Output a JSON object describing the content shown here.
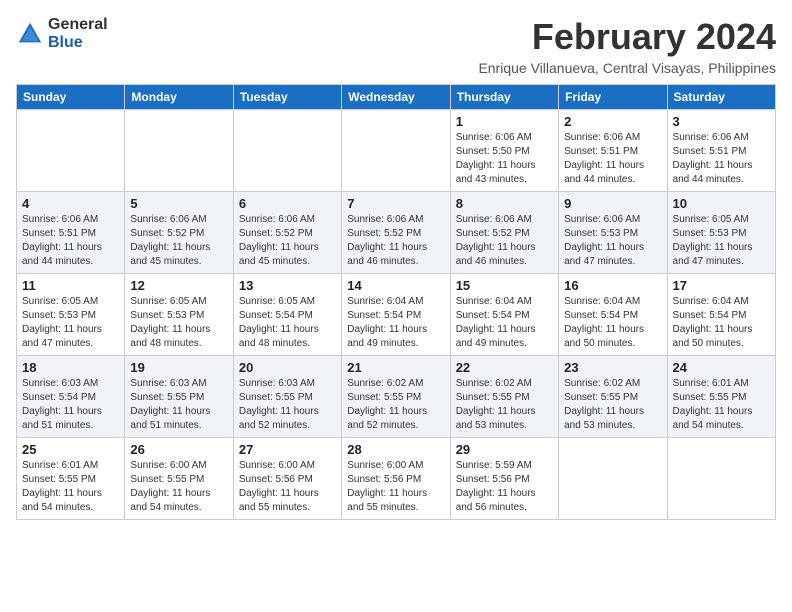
{
  "logo": {
    "general": "General",
    "blue": "Blue"
  },
  "title": {
    "month_year": "February 2024",
    "subtitle": "Enrique Villanueva, Central Visayas, Philippines"
  },
  "weekdays": [
    "Sunday",
    "Monday",
    "Tuesday",
    "Wednesday",
    "Thursday",
    "Friday",
    "Saturday"
  ],
  "weeks": [
    [
      {
        "day": "",
        "info": ""
      },
      {
        "day": "",
        "info": ""
      },
      {
        "day": "",
        "info": ""
      },
      {
        "day": "",
        "info": ""
      },
      {
        "day": "1",
        "info": "Sunrise: 6:06 AM\nSunset: 5:50 PM\nDaylight: 11 hours and 43 minutes."
      },
      {
        "day": "2",
        "info": "Sunrise: 6:06 AM\nSunset: 5:51 PM\nDaylight: 11 hours and 44 minutes."
      },
      {
        "day": "3",
        "info": "Sunrise: 6:06 AM\nSunset: 5:51 PM\nDaylight: 11 hours and 44 minutes."
      }
    ],
    [
      {
        "day": "4",
        "info": "Sunrise: 6:06 AM\nSunset: 5:51 PM\nDaylight: 11 hours and 44 minutes."
      },
      {
        "day": "5",
        "info": "Sunrise: 6:06 AM\nSunset: 5:52 PM\nDaylight: 11 hours and 45 minutes."
      },
      {
        "day": "6",
        "info": "Sunrise: 6:06 AM\nSunset: 5:52 PM\nDaylight: 11 hours and 45 minutes."
      },
      {
        "day": "7",
        "info": "Sunrise: 6:06 AM\nSunset: 5:52 PM\nDaylight: 11 hours and 46 minutes."
      },
      {
        "day": "8",
        "info": "Sunrise: 6:06 AM\nSunset: 5:52 PM\nDaylight: 11 hours and 46 minutes."
      },
      {
        "day": "9",
        "info": "Sunrise: 6:06 AM\nSunset: 5:53 PM\nDaylight: 11 hours and 47 minutes."
      },
      {
        "day": "10",
        "info": "Sunrise: 6:05 AM\nSunset: 5:53 PM\nDaylight: 11 hours and 47 minutes."
      }
    ],
    [
      {
        "day": "11",
        "info": "Sunrise: 6:05 AM\nSunset: 5:53 PM\nDaylight: 11 hours and 47 minutes."
      },
      {
        "day": "12",
        "info": "Sunrise: 6:05 AM\nSunset: 5:53 PM\nDaylight: 11 hours and 48 minutes."
      },
      {
        "day": "13",
        "info": "Sunrise: 6:05 AM\nSunset: 5:54 PM\nDaylight: 11 hours and 48 minutes."
      },
      {
        "day": "14",
        "info": "Sunrise: 6:04 AM\nSunset: 5:54 PM\nDaylight: 11 hours and 49 minutes."
      },
      {
        "day": "15",
        "info": "Sunrise: 6:04 AM\nSunset: 5:54 PM\nDaylight: 11 hours and 49 minutes."
      },
      {
        "day": "16",
        "info": "Sunrise: 6:04 AM\nSunset: 5:54 PM\nDaylight: 11 hours and 50 minutes."
      },
      {
        "day": "17",
        "info": "Sunrise: 6:04 AM\nSunset: 5:54 PM\nDaylight: 11 hours and 50 minutes."
      }
    ],
    [
      {
        "day": "18",
        "info": "Sunrise: 6:03 AM\nSunset: 5:54 PM\nDaylight: 11 hours and 51 minutes."
      },
      {
        "day": "19",
        "info": "Sunrise: 6:03 AM\nSunset: 5:55 PM\nDaylight: 11 hours and 51 minutes."
      },
      {
        "day": "20",
        "info": "Sunrise: 6:03 AM\nSunset: 5:55 PM\nDaylight: 11 hours and 52 minutes."
      },
      {
        "day": "21",
        "info": "Sunrise: 6:02 AM\nSunset: 5:55 PM\nDaylight: 11 hours and 52 minutes."
      },
      {
        "day": "22",
        "info": "Sunrise: 6:02 AM\nSunset: 5:55 PM\nDaylight: 11 hours and 53 minutes."
      },
      {
        "day": "23",
        "info": "Sunrise: 6:02 AM\nSunset: 5:55 PM\nDaylight: 11 hours and 53 minutes."
      },
      {
        "day": "24",
        "info": "Sunrise: 6:01 AM\nSunset: 5:55 PM\nDaylight: 11 hours and 54 minutes."
      }
    ],
    [
      {
        "day": "25",
        "info": "Sunrise: 6:01 AM\nSunset: 5:55 PM\nDaylight: 11 hours and 54 minutes."
      },
      {
        "day": "26",
        "info": "Sunrise: 6:00 AM\nSunset: 5:55 PM\nDaylight: 11 hours and 54 minutes."
      },
      {
        "day": "27",
        "info": "Sunrise: 6:00 AM\nSunset: 5:56 PM\nDaylight: 11 hours and 55 minutes."
      },
      {
        "day": "28",
        "info": "Sunrise: 6:00 AM\nSunset: 5:56 PM\nDaylight: 11 hours and 55 minutes."
      },
      {
        "day": "29",
        "info": "Sunrise: 5:59 AM\nSunset: 5:56 PM\nDaylight: 11 hours and 56 minutes."
      },
      {
        "day": "",
        "info": ""
      },
      {
        "day": "",
        "info": ""
      }
    ]
  ]
}
